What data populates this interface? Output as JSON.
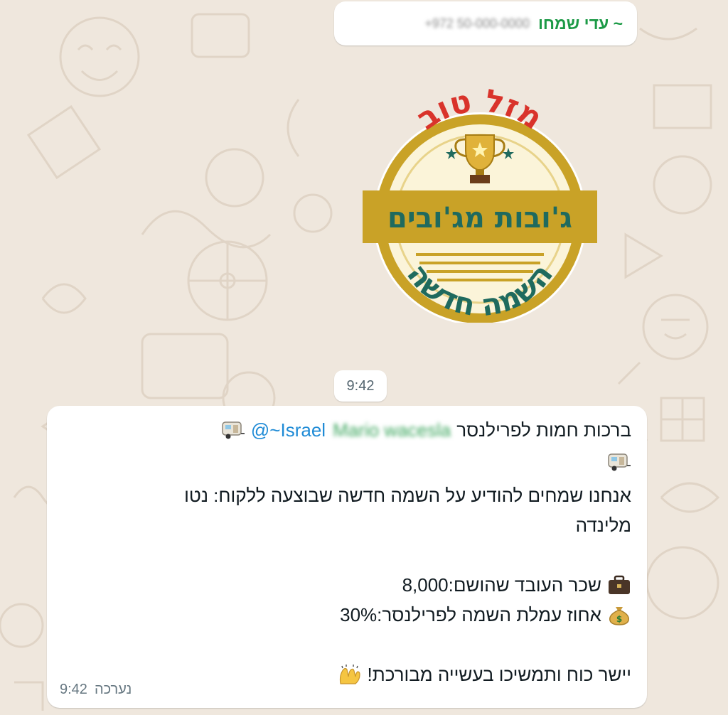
{
  "sender": {
    "prefix": "~",
    "name": "עדי שמחו",
    "phone": "+972 50-000-0000"
  },
  "sticker": {
    "top_text": "מזל טוב",
    "band_text": "ג'ובות מג'ובים",
    "bottom_text": "השמה חדשה",
    "icon": "trophy-icon",
    "colors": {
      "gold": "#c9a227",
      "red": "#d9332b",
      "teal": "#1f6a5e",
      "cream": "#fbf4d9"
    }
  },
  "date_pill": {
    "time": "9:42"
  },
  "message": {
    "mention_handle": "@~Israel",
    "mention_blurred": "Mario wacesla",
    "line1_text": "ברכות חמות לפרילנסר",
    "line1_emoji": "caravan-icon",
    "line2_emoji": "caravan-icon",
    "line3": "אנחנו שמחים להודיע על השמה חדשה שבוצעה ללקוח: נטו",
    "line4": "מלינדה",
    "salary_line": "שכר העובד שהושם:8,000",
    "salary_emoji": "briefcase-icon",
    "commission_line": "אחוז עמלת השמה לפרילנסר:30%",
    "commission_emoji": "money-bag-icon",
    "closing_line": "יישר כוח ותמשיכו בעשייה מבורכת!",
    "closing_emoji": "raised-hands-icon",
    "status": "נערכה",
    "time": "9:42"
  },
  "colors": {
    "background": "#efe7dd",
    "bubble": "#ffffff",
    "sender_green": "#1c9a46",
    "mention_blue": "#1f8bd6"
  }
}
